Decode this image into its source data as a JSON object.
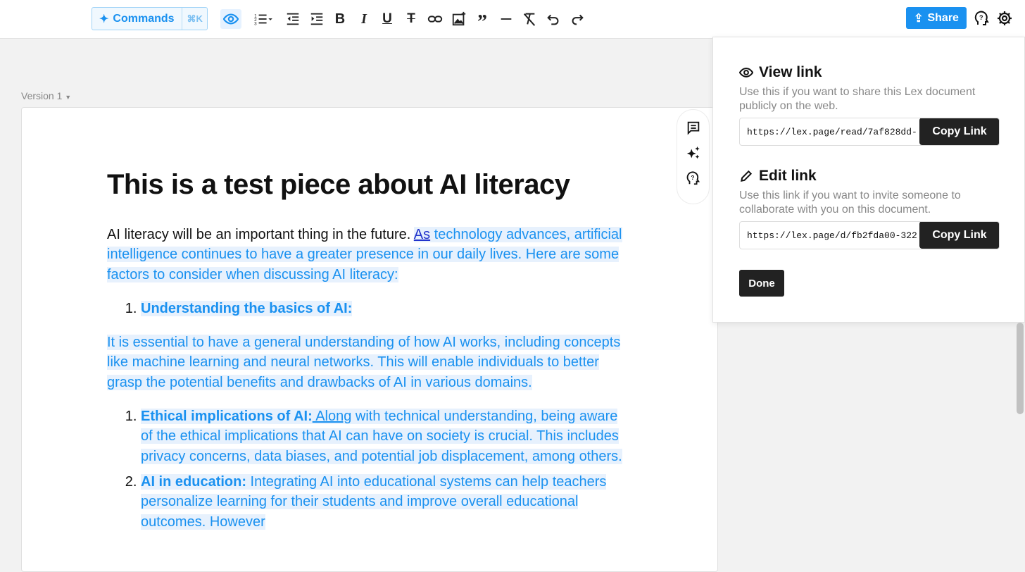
{
  "toolbar": {
    "commands_label": "Commands",
    "commands_shortcut": "⌘K",
    "buttons": [
      "preview",
      "numbered-list",
      "outdent",
      "indent",
      "bold",
      "italic",
      "underline",
      "strikethrough",
      "link",
      "image",
      "quote",
      "horizontal-rule",
      "clear-format",
      "undo",
      "redo"
    ],
    "share_label": "Share"
  },
  "document": {
    "version_label": "Version 1",
    "title": "This is a test piece about AI literacy",
    "intro_plain": "AI literacy will be an important thing in the future. ",
    "intro_link": "As",
    "intro_highlight": " technology advances, artificial intelligence continues to have a greater presence in our daily lives. Here are some factors to consider when discussing AI literacy:",
    "list1": [
      {
        "number": "1.",
        "bold": "Understanding the basics of AI:"
      }
    ],
    "para2": " It is essential to have a general understanding of how AI works, including concepts like machine learning and neural networks. This will enable individuals to better grasp the potential benefits and drawbacks of AI in various domains.",
    "list2": [
      {
        "bold": "Ethical implications of AI:",
        "link": " Along",
        "text": " with technical understanding, being aware of the ethical implications that AI can have on society is crucial. This includes privacy concerns, data biases, and potential job displacement, among others."
      },
      {
        "bold": "AI in education:",
        "text": " Integrating AI into educational systems can help teachers personalize learning for their students and improve overall educational outcomes. However"
      }
    ]
  },
  "share_panel": {
    "view": {
      "title": "View link",
      "description": "Use this if you want to share this Lex document publicly on the web.",
      "url": "https://lex.page/read/7af828dd-",
      "button": "Copy Link"
    },
    "edit": {
      "title": "Edit link",
      "description": "Use this link if you want to invite someone to collaborate with you on this document.",
      "url": "https://lex.page/d/fb2fda00-322",
      "button": "Copy Link"
    },
    "done_label": "Done"
  }
}
